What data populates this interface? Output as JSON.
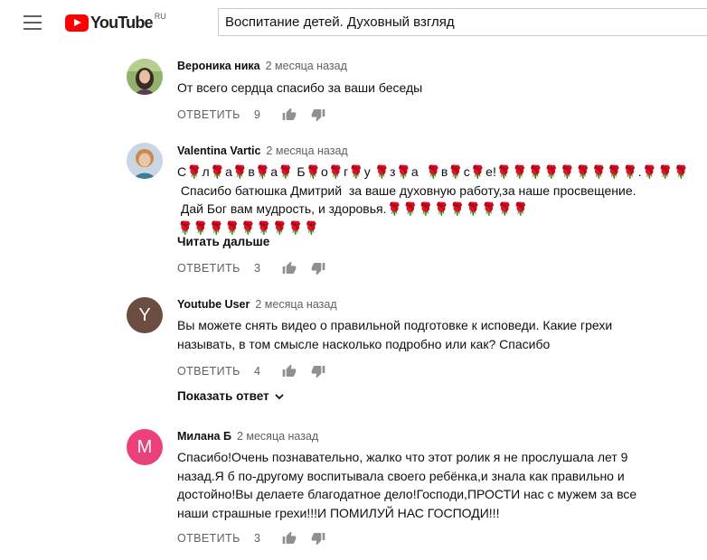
{
  "header": {
    "logo_text": "YouTube",
    "region": "RU",
    "search_value": "Воспитание детей. Духовный взгляд"
  },
  "comments": [
    {
      "author": "Вероника ника",
      "time": "2 месяца назад",
      "lines": [
        "От всего сердца спасибо за ваши беседы"
      ],
      "reply_label": "ОТВЕТИТЬ",
      "likes": "9",
      "avatar_type": "photo"
    },
    {
      "author": "Valentina Vartic",
      "time": "2 месяца назад",
      "lines": [
        "С🌹л🌹а🌹в🌹а🌹 Б🌹о🌹г🌹у 🌹з🌹а  🌹в🌹с🌹е!🌹🌹🌹🌹🌹🌹🌹🌹🌹.🌹🌹🌹",
        " Спасибо батюшка Дмитрий  за ваше духовную работу,за наше просвещение.",
        " Дай Бог вам мудрость, и здоровья.🌹🌹🌹🌹🌹🌹🌹🌹🌹",
        "🌹🌹🌹🌹🌹🌹🌹🌹🌹"
      ],
      "read_more": "Читать дальше",
      "reply_label": "ОТВЕТИТЬ",
      "likes": "3",
      "avatar_type": "photo"
    },
    {
      "author": "Youtube User",
      "time": "2 месяца назад",
      "lines": [
        "Вы можете снять видео о правильной подготовке к исповеди. Какие грехи",
        "называть, в том смысле насколько подробно или как? Спасибо"
      ],
      "reply_label": "ОТВЕТИТЬ",
      "likes": "4",
      "avatar_letter": "Y",
      "avatar_color": "#6d4c41",
      "show_replies": "Показать ответ"
    },
    {
      "author": "Милана Б",
      "time": "2 месяца назад",
      "lines": [
        "Спасибо!Очень познавательно, жалко что этот ролик я не прослушала лет 9",
        "назад.Я б по-другому воспитывала своего ребёнка,и знала как правильно и",
        "достойно!Вы делаете благодатное дело!Господи,ПРОСТИ нас с мужем за все",
        "наши страшные грехи!!!И ПОМИЛУЙ НАС ГОСПОДИ!!!"
      ],
      "reply_label": "ОТВЕТИТЬ",
      "likes": "3",
      "avatar_letter": "М",
      "avatar_color": "#ec407a"
    }
  ]
}
